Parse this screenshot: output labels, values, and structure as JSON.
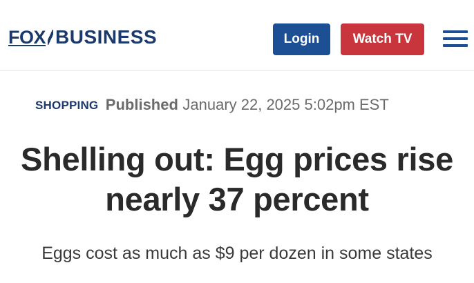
{
  "header": {
    "logo": {
      "fox": "FOX",
      "business": "BUSINESS"
    },
    "login_label": "Login",
    "watch_tv_label": "Watch TV",
    "menu_icon": "hamburger-menu-icon"
  },
  "article": {
    "category": "SHOPPING",
    "published_label": "Published",
    "published_date": "January 22, 2025 5:02pm EST",
    "headline": "Shelling out: Egg prices rise nearly 37 percent",
    "subheadline": "Eggs cost as much as $9 per dozen in some states"
  },
  "colors": {
    "brand_navy": "#1b3a6b",
    "login_blue": "#1c4f93",
    "watch_red": "#c8353c",
    "meta_gray": "#6b6b6b"
  }
}
